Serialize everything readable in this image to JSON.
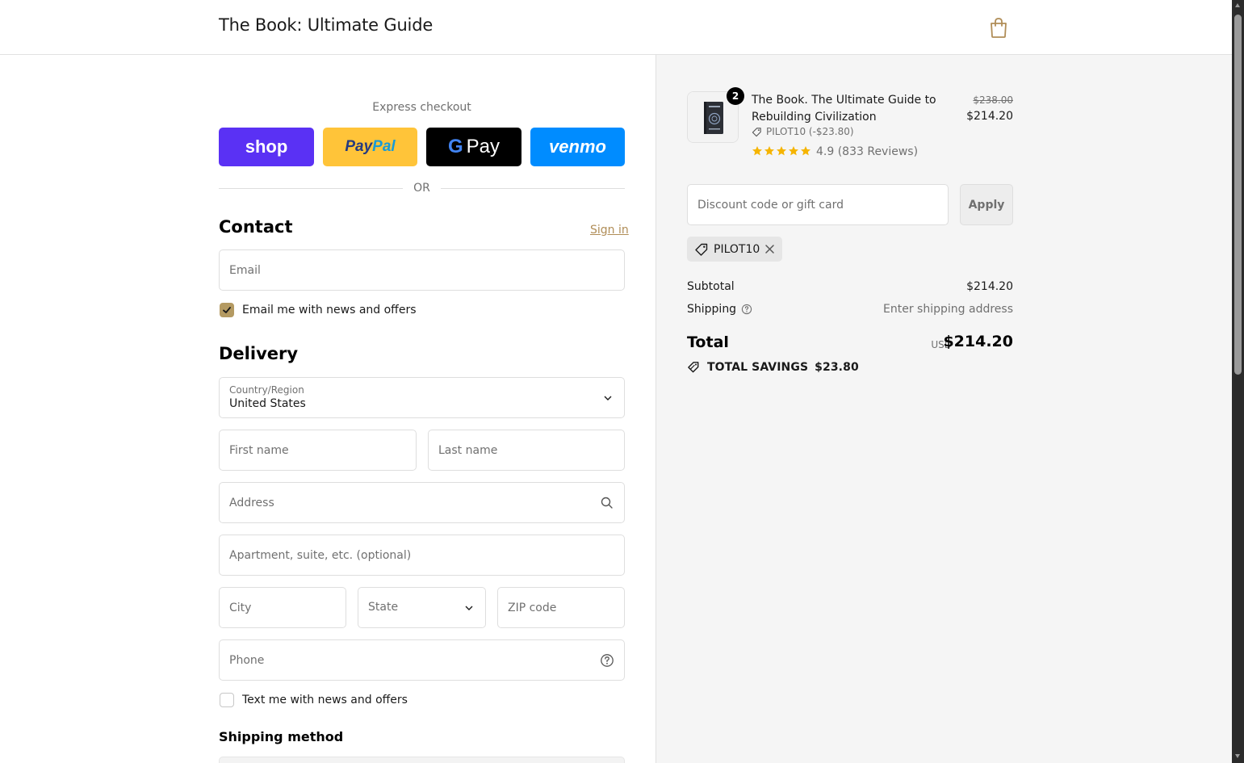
{
  "header": {
    "store_title": "The Book: Ultimate Guide",
    "cart_icon": "shopping-bag-icon"
  },
  "express": {
    "label": "Express checkout",
    "shop_label": "shop",
    "paypal_label_a": "Pay",
    "paypal_label_b": "Pal",
    "gpay_g": "G",
    "gpay_label": "Pay",
    "venmo_label": "venmo",
    "or_label": "OR"
  },
  "contact": {
    "title": "Contact",
    "signin_label": "Sign in",
    "email_placeholder": "Email",
    "news_label": "Email me with news and offers",
    "news_checked": true
  },
  "delivery": {
    "title": "Delivery",
    "country_label": "Country/Region",
    "country_value": "United States",
    "first_name_placeholder": "First name",
    "last_name_placeholder": "Last name",
    "address_placeholder": "Address",
    "apartment_placeholder": "Apartment, suite, etc. (optional)",
    "city_placeholder": "City",
    "state_placeholder": "State",
    "zip_placeholder": "ZIP code",
    "phone_placeholder": "Phone",
    "sms_label": "Text me with news and offers",
    "sms_checked": false,
    "shipping_method_title": "Shipping method"
  },
  "order": {
    "quantity": "2",
    "product_name": "The Book. The Ultimate Guide to Rebuilding Civilization",
    "product_discount": "PILOT10 (-$23.80)",
    "rating": 5,
    "rating_text": "4.9 (833 Reviews)",
    "old_price": "$238.00",
    "new_price": "$214.20",
    "discount_placeholder": "Discount code or gift card",
    "apply_label": "Apply",
    "applied_code": "PILOT10",
    "subtotal_label": "Subtotal",
    "subtotal_value": "$214.20",
    "shipping_label": "Shipping",
    "shipping_value": "Enter shipping address",
    "total_label": "Total",
    "total_currency": "USD",
    "total_value": "$214.20",
    "savings_label": "TOTAL SAVINGS",
    "savings_value": "$23.80"
  },
  "colors": {
    "shop": "#5a31f4",
    "paypal": "#ffc439",
    "gpay": "#000000",
    "venmo": "#008cff",
    "accent": "#b49a62",
    "star": "#f5b400"
  }
}
